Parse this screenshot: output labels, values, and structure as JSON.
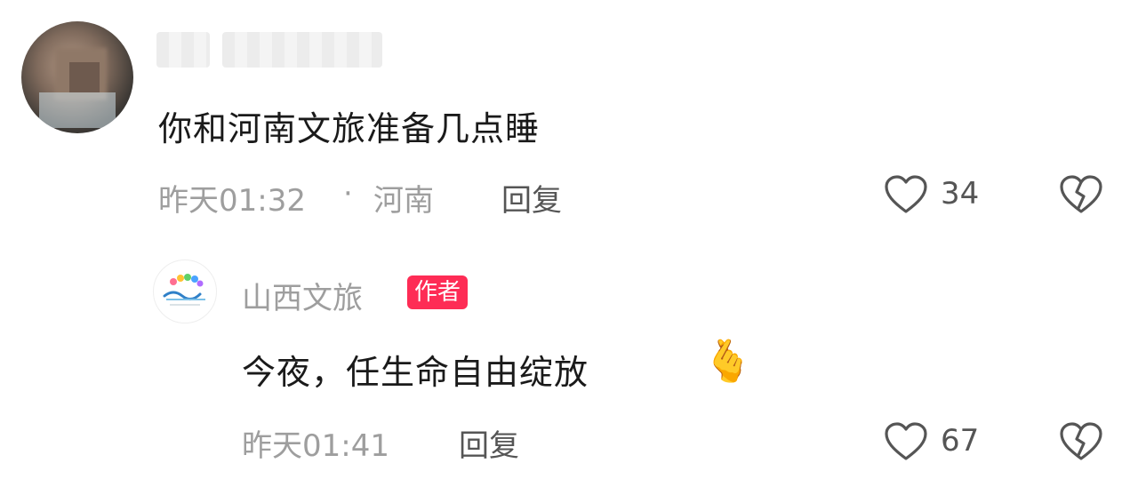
{
  "comment": {
    "text": "你和河南文旅准备几点睡",
    "time": "昨天01:32",
    "separator": "·",
    "location": "河南",
    "reply_label": "回复",
    "like_count": "34"
  },
  "reply": {
    "author": "山西文旅",
    "badge": "作者",
    "text": "今夜，任生命自由绽放",
    "emoji": "🫰",
    "time": "昨天01:41",
    "reply_label": "回复",
    "like_count": "67"
  },
  "colors": {
    "badge": "#fe2c55",
    "meta": "#9e9e9e",
    "text": "#1a1a1a"
  },
  "icons": {
    "like": "heart-outline-icon",
    "dislike": "broken-heart-icon"
  }
}
